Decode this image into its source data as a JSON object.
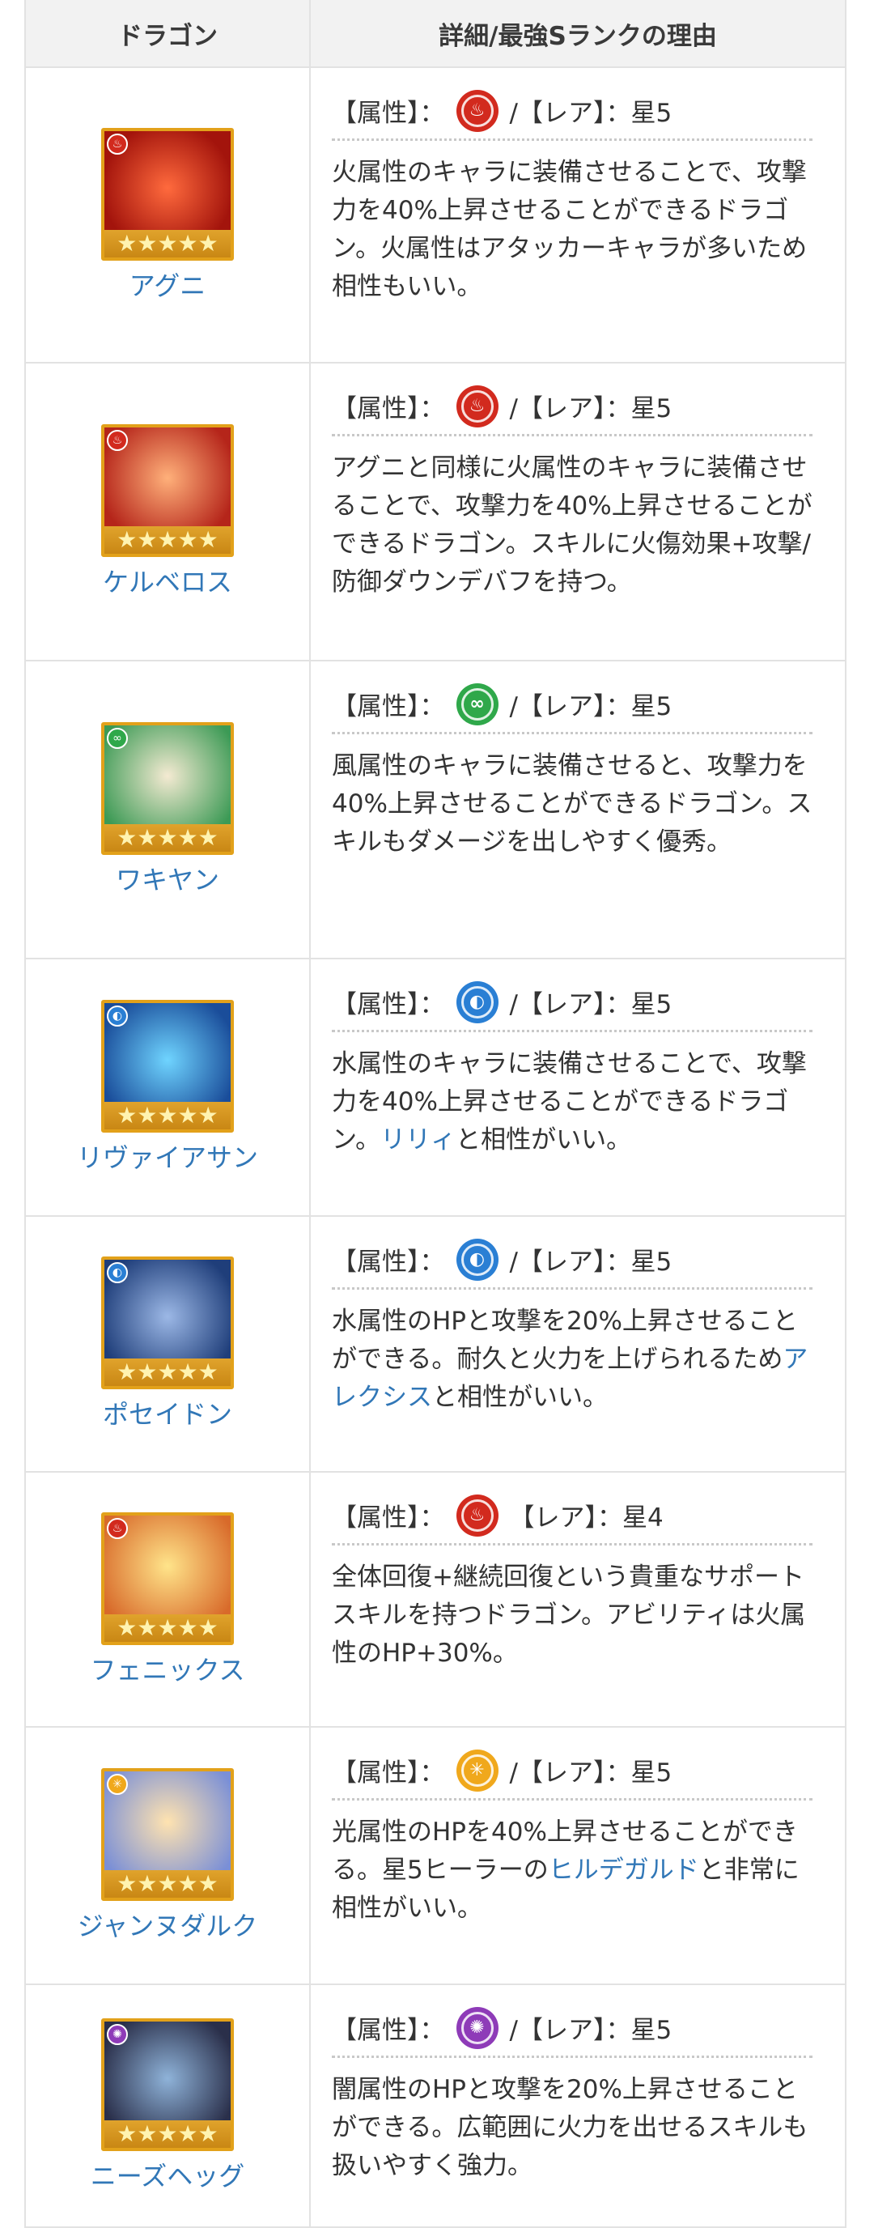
{
  "header": {
    "col_dragon": "ドラゴン",
    "col_detail": "詳細/最強Sランクの理由"
  },
  "rows": [
    {
      "name": "アグニ",
      "attr_label": "【属性】：",
      "rare_label": "/【レア】：星5",
      "desc": "火属性のキャラに装備させることで、攻撃力を40%上昇させることができるドラゴン。火属性はアタッカーキャラが多いため相性もいい。",
      "icon": "fire-icon",
      "color": "#d22a1e"
    },
    {
      "name": "ケルベロス",
      "attr_label": "【属性】：",
      "rare_label": "/【レア】：星5",
      "desc": "アグニと同様に火属性のキャラに装備させることで、攻撃力を40%上昇させることができるドラゴン。スキルに火傷効果+攻撃/防御ダウンデバフを持つ。",
      "icon": "fire-icon",
      "color": "#d22a1e"
    },
    {
      "name": "ワキヤン",
      "attr_label": "【属性】：",
      "rare_label": "/【レア】：星5",
      "desc": "風属性のキャラに装備させると、攻撃力を40%上昇させることができるドラゴン。スキルもダメージを出しやすく優秀。",
      "icon": "wind-icon",
      "color": "#2fa84a"
    },
    {
      "name": "リヴァイアサン",
      "attr_label": "【属性】：",
      "rare_label": "/【レア】：星5",
      "desc_pre": "水属性のキャラに装備させることで、攻撃力を40%上昇させることができるドラゴン。",
      "link": "リリィ",
      "desc_post": "と相性がいい。",
      "icon": "water-icon",
      "color": "#2a7fd4"
    },
    {
      "name": "ポセイドン",
      "attr_label": "【属性】：",
      "rare_label": "/【レア】：星5",
      "desc_pre": "水属性のHPと攻撃を20%上昇させることができる。耐久と火力を上げられるため",
      "link": "アレクシス",
      "desc_post": "と相性がいい。",
      "icon": "water-icon",
      "color": "#2a7fd4"
    },
    {
      "name": "フェニックス",
      "attr_label": "【属性】：",
      "rare_label": "【レア】：星4",
      "desc": "全体回復+継続回復という貴重なサポートスキルを持つドラゴン。アビリティは火属性のHP+30%。",
      "icon": "fire-icon",
      "color": "#d22a1e"
    },
    {
      "name": "ジャンヌダルク",
      "attr_label": "【属性】：",
      "rare_label": "/【レア】：星5",
      "desc_pre": "光属性のHPを40%上昇させることができる。星5ヒーラーの",
      "link": "ヒルデガルド",
      "desc_post": "と非常に相性がいい。",
      "icon": "light-icon",
      "color": "#f0a81c"
    },
    {
      "name": "ニーズヘッグ",
      "attr_label": "【属性】：",
      "rare_label": "/【レア】：星5",
      "desc": "闇属性のHPと攻撃を20%上昇させることができる。広範囲に火力を出せるスキルも扱いやすく強力。",
      "icon": "dark-icon",
      "color": "#8e3bb8"
    }
  ]
}
